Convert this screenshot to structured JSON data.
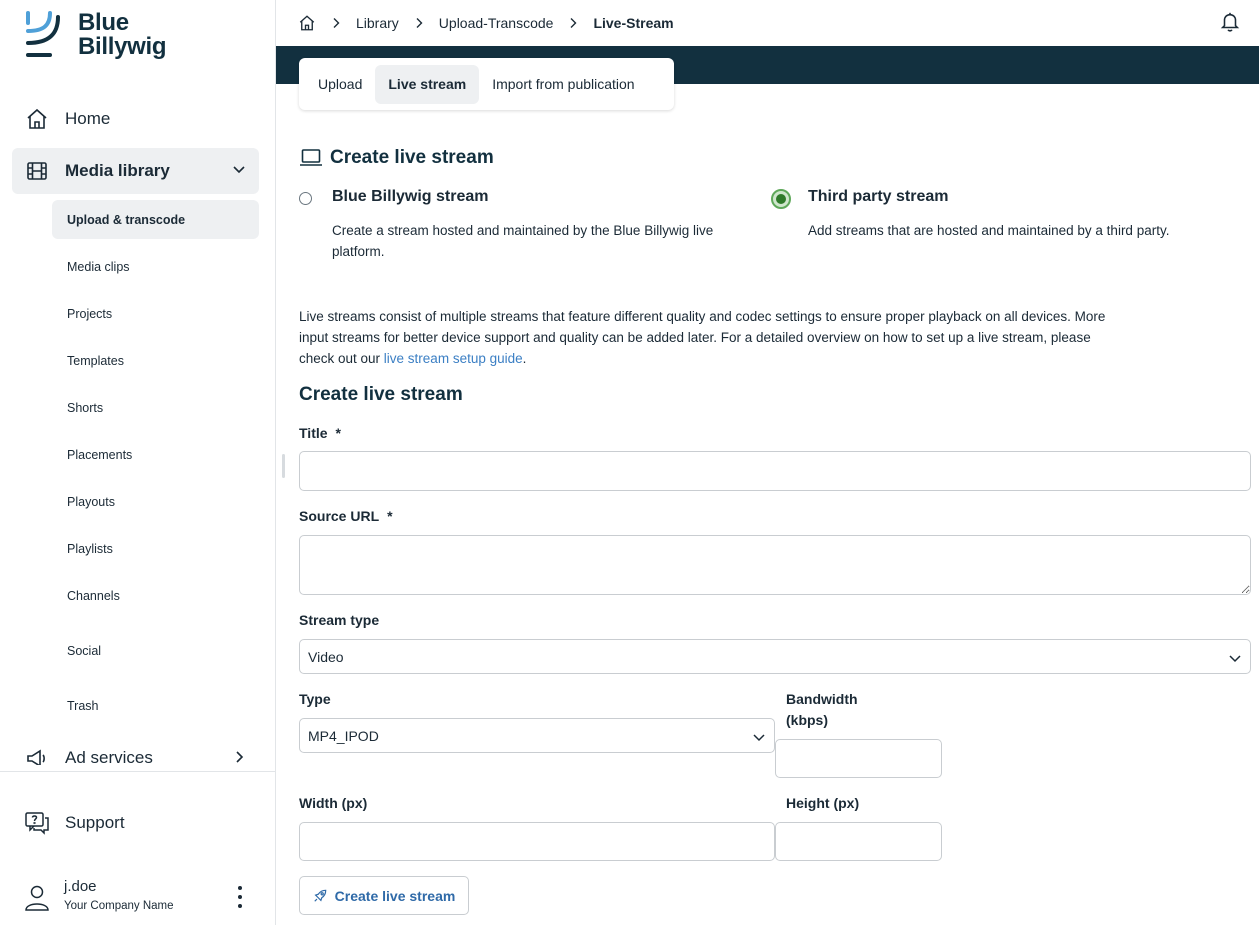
{
  "brand": {
    "line1": "Blue",
    "line2": "Billywig"
  },
  "sidebar": {
    "home": {
      "label": "Home",
      "icon": "home-icon"
    },
    "media_library": {
      "label": "Media library",
      "icon": "film-icon"
    },
    "sub_items": [
      "Upload & transcode",
      "Media clips",
      "Projects",
      "Templates",
      "Shorts",
      "Placements",
      "Playouts",
      "Playlists",
      "Channels",
      "Social",
      "Trash"
    ],
    "ad_services": {
      "label": "Ad services",
      "icon": "megaphone-icon"
    },
    "support": {
      "label": "Support",
      "icon": "support-chat-icon"
    },
    "user": {
      "name": "j.doe",
      "company": "Your Company Name"
    }
  },
  "breadcrumb": {
    "library": "Library",
    "upload": "Upload-Transcode",
    "current": "Live-Stream"
  },
  "tabs": {
    "upload": "Upload",
    "live": "Live stream",
    "import": "Import from publication"
  },
  "section": {
    "title": "Create live stream"
  },
  "options": {
    "bb": {
      "title": "Blue Billywig stream",
      "desc": "Create a stream hosted and maintained by the Blue Billywig live platform.",
      "checked": false
    },
    "third": {
      "title": "Third party stream",
      "desc": "Add streams that are hosted and maintained by a third party.",
      "checked": true
    }
  },
  "info": {
    "text": "Live streams consist of multiple streams that feature different quality and codec settings to ensure proper playback on all devices. More input streams for better device support and quality can be added later. For a detailed overview on how to set up a live stream, please check out our ",
    "link": "live stream setup guide",
    "suffix": "."
  },
  "form": {
    "title": "Create live stream",
    "title_label": "Title",
    "title_value": "",
    "required_mark": "*",
    "source_label": "Source URL",
    "source_value": "",
    "stream_type_label": "Stream type",
    "stream_type_value": "Video",
    "type_label": "Type",
    "type_value": "MP4_IPOD",
    "bandwidth_label": "Bandwidth (kbps)",
    "bandwidth_value": "",
    "width_label": "Width (px)",
    "width_value": "",
    "height_label": "Height (px)",
    "height_value": "",
    "submit": "Create live stream"
  },
  "colors": {
    "accent_dark": "#12303f",
    "link": "#3b7fc4",
    "radio_on": "#5fa85a"
  }
}
